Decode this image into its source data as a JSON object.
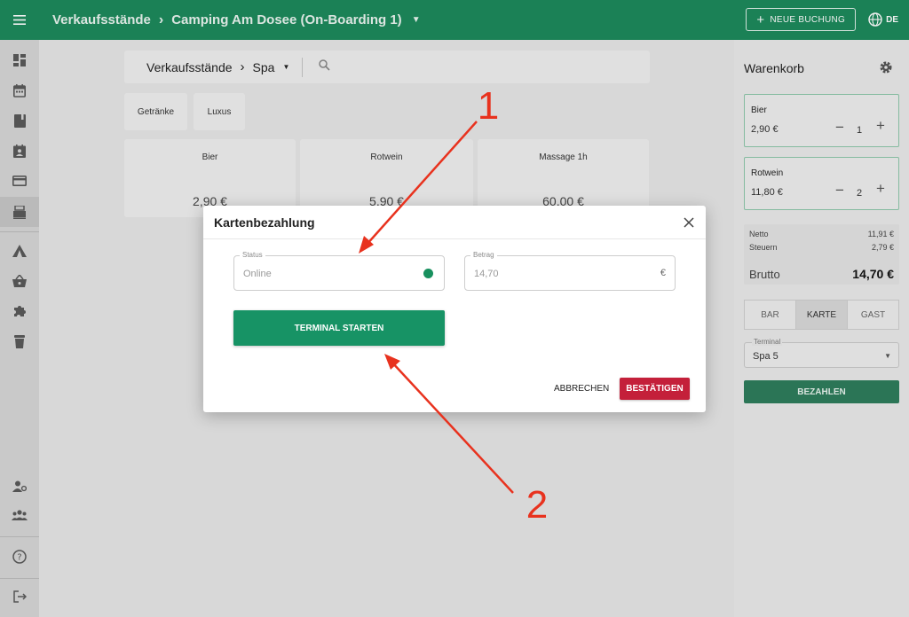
{
  "topbar": {
    "menu_icon": "hamburger-menu-icon",
    "breadcrumb_root": "Verkaufsstände",
    "breadcrumb_current": "Camping Am Dosee (On-Boarding 1)",
    "new_booking_label": "NEUE BUCHUNG",
    "language": "DE",
    "accent_color": "#1d8a5c"
  },
  "sidebar": {
    "icons": [
      "dashboard-icon",
      "calendar-icon",
      "book-icon",
      "contact-calendar-icon",
      "credit-card-icon",
      "point-of-sale-icon",
      "camping-tent-icon",
      "shopping-basket-icon",
      "extension-icon",
      "trash-bin-icon",
      "user-settings-icon",
      "group-icon",
      "help-icon",
      "logout-icon"
    ],
    "active": "point-of-sale-icon"
  },
  "main": {
    "title": "Verkaufsstände",
    "stand": "Spa",
    "categories": [
      "Getränke",
      "Luxus"
    ],
    "products": [
      {
        "name": "Bier",
        "price": "2,90 €"
      },
      {
        "name": "Rotwein",
        "price": "5,90 €"
      },
      {
        "name": "Massage 1h",
        "price": "60,00 €"
      }
    ]
  },
  "cart": {
    "title": "Warenkorb",
    "items": [
      {
        "name": "Bier",
        "price": "2,90 €",
        "qty": "1"
      },
      {
        "name": "Rotwein",
        "price": "11,80 €",
        "qty": "2"
      }
    ],
    "netto_label": "Netto",
    "netto_value": "11,91 €",
    "steuern_label": "Steuern",
    "steuern_value": "2,79 €",
    "brutto_label": "Brutto",
    "brutto_value": "14,70 €",
    "pay_tabs": [
      "BAR",
      "KARTE",
      "GAST"
    ],
    "active_tab": "KARTE",
    "terminal_label": "Terminal",
    "terminal_value": "Spa 5",
    "pay_label": "BEZAHLEN"
  },
  "dialog": {
    "title": "Kartenbezahlung",
    "status_label": "Status",
    "status_value": "Online",
    "status_color": "#18905e",
    "amount_label": "Betrag",
    "amount_value": "14,70",
    "currency": "€",
    "start_label": "TERMINAL STARTEN",
    "cancel_label": "ABBRECHEN",
    "confirm_label": "BESTÄTIGEN",
    "confirm_color": "#c4203a"
  },
  "annotations": {
    "label_1": "1",
    "label_2": "2",
    "arrow_color": "#e8321e"
  }
}
